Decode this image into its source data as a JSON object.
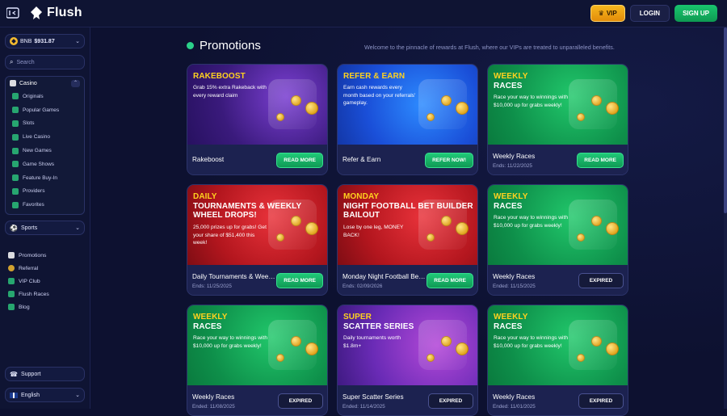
{
  "topbar": {
    "brand": "Flush",
    "vip_label": "VIP",
    "login_label": "LOGIN",
    "signup_label": "SIGN UP"
  },
  "sidebar": {
    "wallet": {
      "currency": "BNB",
      "amount": "$931.87"
    },
    "search_placeholder": "Search",
    "casino": {
      "label": "Casino",
      "items": [
        "Originals",
        "Popular Games",
        "Slots",
        "Live Casino",
        "New Games",
        "Game Shows",
        "Feature Buy-In",
        "Providers",
        "Favorites"
      ]
    },
    "sports": {
      "label": "Sports"
    },
    "links": [
      "Promotions",
      "Referral",
      "VIP Club",
      "Flush Races",
      "Blog"
    ],
    "support": "Support",
    "language": "English"
  },
  "main": {
    "title": "Promotions",
    "subtitle": "Welcome to the pinnacle of rewards at Flush, where our VIPs are treated to unparalleled benefits."
  },
  "cards": [
    {
      "art": "purple",
      "hl1": "RAKEBOOST",
      "hl2": "",
      "desc": "Grab 15% extra Rakeback with every reward claim",
      "name": "Rakeboost",
      "date": "",
      "button": "READ MORE",
      "button_style": "green"
    },
    {
      "art": "blue",
      "hl1": "REFER & EARN",
      "hl2": "",
      "desc": "Earn cash rewards every month based on your referrals' gameplay.",
      "name": "Refer & Earn",
      "date": "",
      "button": "REFER NOW!",
      "button_style": "green"
    },
    {
      "art": "green",
      "hl1": "WEEKLY",
      "hl2": "RACES",
      "desc": "Race your way to winnings with $10,000 up for grabs weekly!",
      "name": "Weekly Races",
      "date": "Ends: 11/22/2025",
      "button": "READ MORE",
      "button_style": "green"
    },
    {
      "art": "red",
      "hl1": "DAILY",
      "hl2": "TOURNAMENTS & WEEKLY WHEEL DROPS!",
      "desc": "25,000 prizes up for grabs! Get your share of $51,400 this week!",
      "name": "Daily Tournaments & Weekly Wheel Drops!",
      "date": "Ends: 11/25/2025",
      "button": "READ MORE",
      "button_style": "green"
    },
    {
      "art": "red",
      "hl1": "MONDAY",
      "hl2": "NIGHT FOOTBALL BET BUILDER BAILOUT",
      "desc": "Lose by one leg, MONEY BACK!",
      "name": "Monday Night Football Bet Builder Bailout",
      "date": "Ends: 02/09/2026",
      "button": "READ MORE",
      "button_style": "green"
    },
    {
      "art": "green",
      "hl1": "WEEKLY",
      "hl2": "RACES",
      "desc": "Race your way to winnings with $10,000 up for grabs weekly!",
      "name": "Weekly Races",
      "date": "Ended: 11/15/2025",
      "button": "EXPIRED",
      "button_style": "dark"
    },
    {
      "art": "green",
      "hl1": "WEEKLY",
      "hl2": "RACES",
      "desc": "Race your way to winnings with $10,000 up for grabs weekly!",
      "name": "Weekly Races",
      "date": "Ended: 11/08/2025",
      "button": "EXPIRED",
      "button_style": "dark"
    },
    {
      "art": "violet",
      "hl1": "SUPER",
      "hl2": "SCATTER SERIES",
      "desc": "Daily tournaments worth $1.8m+",
      "name": "Super Scatter Series",
      "date": "Ended: 11/14/2025",
      "button": "EXPIRED",
      "button_style": "dark"
    },
    {
      "art": "green",
      "hl1": "WEEKLY",
      "hl2": "RACES",
      "desc": "Race your way to winnings with $10,000 up for grabs weekly!",
      "name": "Weekly Races",
      "date": "Ended: 11/01/2025",
      "button": "EXPIRED",
      "button_style": "dark"
    }
  ],
  "colors": {
    "accent_green": "#19c56e",
    "vip_gold": "#f6b71f",
    "bg": "#0d1130",
    "headline_yellow": "#ffd21f"
  }
}
